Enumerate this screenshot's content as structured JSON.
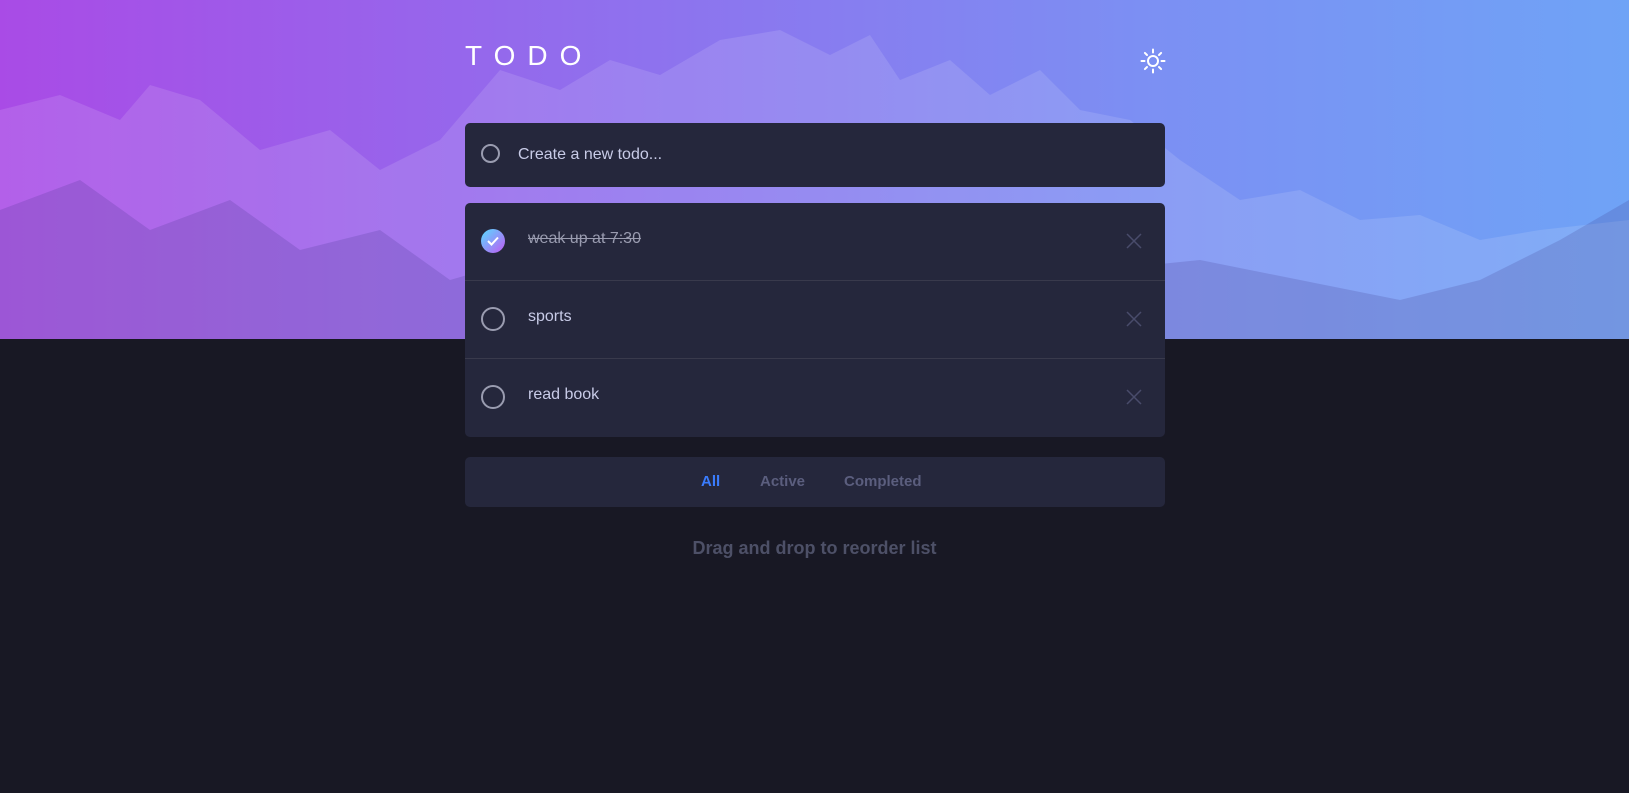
{
  "header": {
    "title": "TODO",
    "theme_toggle_icon": "sun-icon"
  },
  "new_todo": {
    "placeholder": "Create a new todo..."
  },
  "todos": [
    {
      "text": "weak up at 7:30",
      "completed": true
    },
    {
      "text": "sports",
      "completed": false
    },
    {
      "text": "read book",
      "completed": false
    }
  ],
  "filters": {
    "all": "All",
    "active": "Active",
    "completed": "Completed",
    "selected": "All"
  },
  "footer": {
    "hint": "Drag and drop to reorder list"
  },
  "colors": {
    "accent": "#3a7cfd",
    "card": "#25273c",
    "background": "#181824",
    "check_gradient_start": "#57ddff",
    "check_gradient_end": "#c058f3"
  }
}
